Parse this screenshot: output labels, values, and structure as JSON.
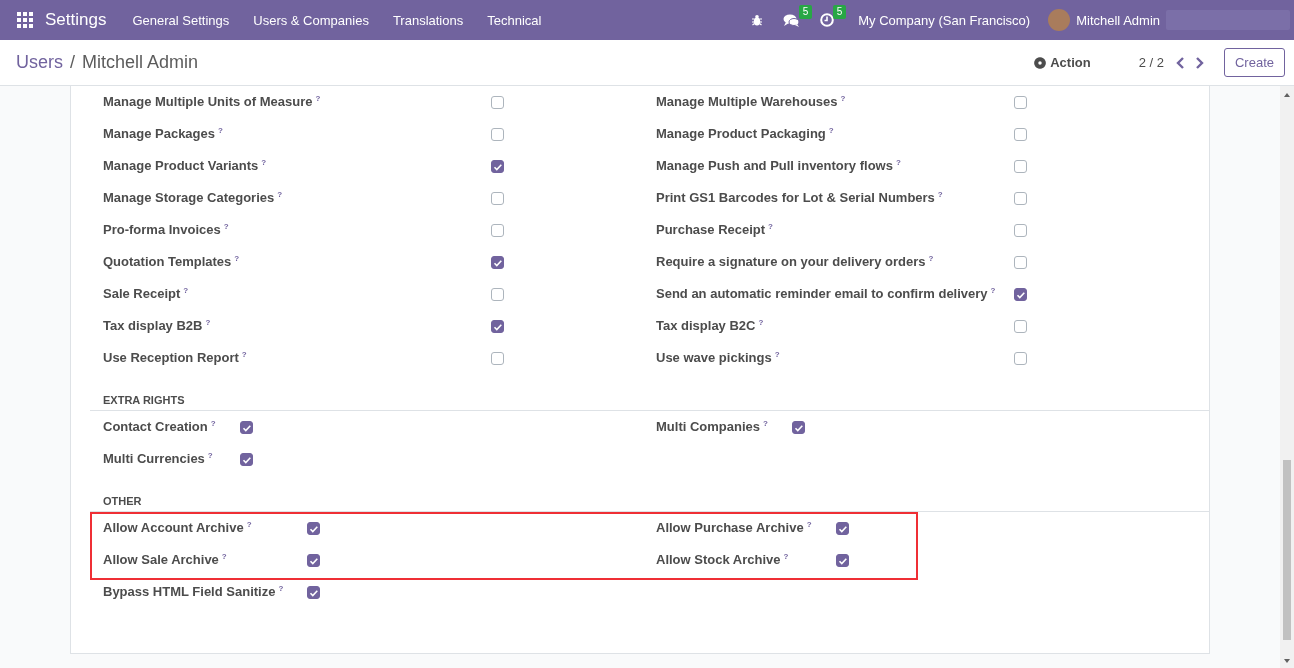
{
  "navbar": {
    "app": "Settings",
    "menu": [
      "General Settings",
      "Users & Companies",
      "Translations",
      "Technical"
    ],
    "chat_badge": "5",
    "activity_badge": "5",
    "company": "My Company (San Francisco)",
    "user": "Mitchell Admin"
  },
  "control_panel": {
    "breadcrumb": [
      {
        "label": "Users",
        "link": true
      },
      {
        "label": "Mitchell Admin",
        "link": false
      }
    ],
    "separator": "/",
    "action": "Action",
    "pager": "2 / 2",
    "create": "Create"
  },
  "sections": [
    {
      "kind": "wide",
      "columns": [
        [
          {
            "label": "Manage Multiple Units of Measure",
            "help": "?",
            "checked": false
          },
          {
            "label": "Manage Packages",
            "help": "?",
            "checked": false
          },
          {
            "label": "Manage Product Variants",
            "help": "?",
            "checked": true
          },
          {
            "label": "Manage Storage Categories",
            "help": "?",
            "checked": false
          },
          {
            "label": "Pro-forma Invoices",
            "help": "?",
            "checked": false
          },
          {
            "label": "Quotation Templates",
            "help": "?",
            "checked": true
          },
          {
            "label": "Sale Receipt",
            "help": "?",
            "checked": false
          },
          {
            "label": "Tax display B2B",
            "help": "?",
            "checked": true
          },
          {
            "label": "Use Reception Report",
            "help": "?",
            "checked": false
          }
        ],
        [
          {
            "label": "Manage Multiple Warehouses",
            "help": "?",
            "checked": false
          },
          {
            "label": "Manage Product Packaging",
            "help": "?",
            "checked": false
          },
          {
            "label": "Manage Push and Pull inventory flows",
            "help": "?",
            "checked": false
          },
          {
            "label": "Print GS1 Barcodes for Lot & Serial Numbers",
            "help": "?",
            "checked": false
          },
          {
            "label": "Purchase Receipt",
            "help": "?",
            "checked": false
          },
          {
            "label": "Require a signature on your delivery orders",
            "help": "?",
            "checked": false
          },
          {
            "label": "Send an automatic reminder email to confirm delivery",
            "help": "?",
            "checked": true
          },
          {
            "label": "Tax display B2C",
            "help": "?",
            "checked": false
          },
          {
            "label": "Use wave pickings",
            "help": "?",
            "checked": false
          }
        ]
      ]
    },
    {
      "kind": "compact",
      "title": "EXTRA RIGHTS",
      "columns": [
        [
          {
            "label": "Contact Creation",
            "help": "?",
            "checked": true
          },
          {
            "label": "Multi Currencies",
            "help": "?",
            "checked": true
          }
        ],
        [
          {
            "label": "Multi Companies",
            "help": "?",
            "checked": true
          }
        ]
      ]
    },
    {
      "kind": "compact",
      "title": "OTHER",
      "columns": [
        [
          {
            "label": "Allow Account Archive",
            "help": "?",
            "checked": true,
            "highlighted": true
          },
          {
            "label": "Allow Sale Archive",
            "help": "?",
            "checked": true,
            "highlighted": true
          },
          {
            "label": "Bypass HTML Field Sanitize",
            "help": "?",
            "checked": true,
            "highlighted": false
          }
        ],
        [
          {
            "label": "Allow Purchase Archive",
            "help": "?",
            "checked": true,
            "highlighted": true
          },
          {
            "label": "Allow Stock Archive",
            "help": "?",
            "checked": true,
            "highlighted": true
          }
        ]
      ]
    }
  ]
}
